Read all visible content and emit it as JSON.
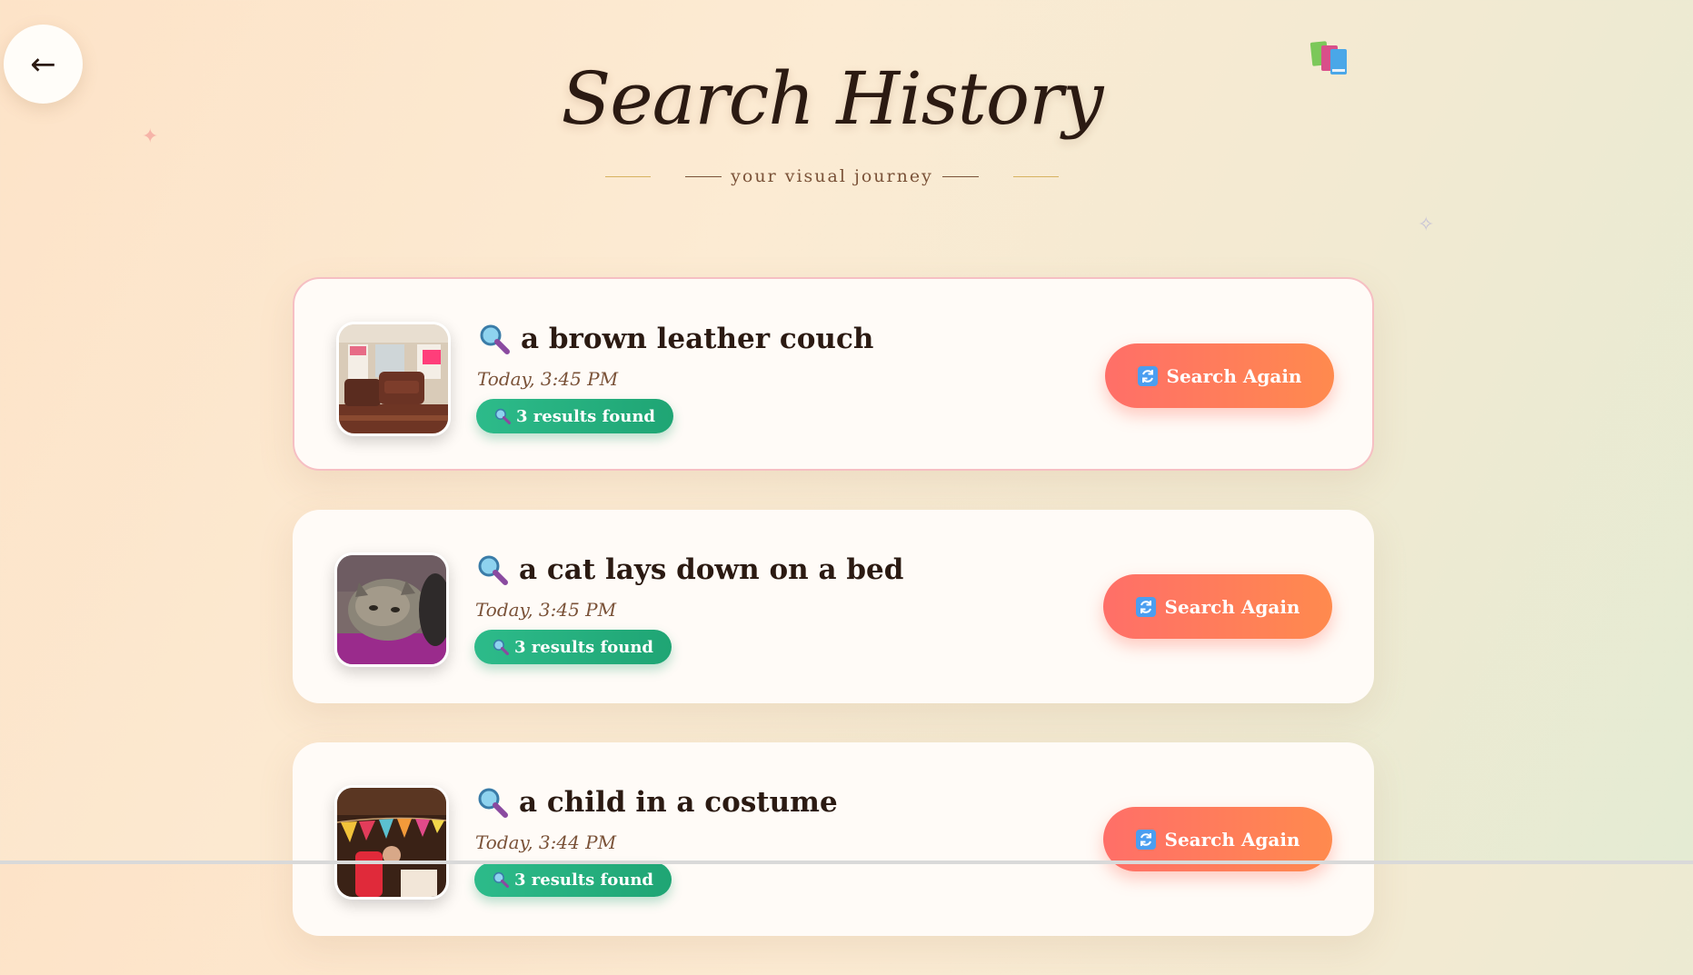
{
  "header": {
    "title": "Search History",
    "subtitle": "your visual journey"
  },
  "back_button": {
    "label": "←"
  },
  "icons": {
    "back": "arrow-left-icon",
    "books": "books-icon",
    "magnifier": "magnifying-glass-icon",
    "refresh": "refresh-icon",
    "sparkle": "sparkle-icon"
  },
  "colors": {
    "accent_button": "#ff7a5c",
    "badge": "#25b381",
    "title": "#2b1a12",
    "timestamp": "#7a5238",
    "active_border": "#f6bfc3"
  },
  "history": [
    {
      "query": "a brown leather couch",
      "timestamp": "Today, 3:45 PM",
      "results": "3 results found",
      "action": "Search Again",
      "active": true,
      "thumbnail": "living-room-couch"
    },
    {
      "query": "a cat lays down on a bed",
      "timestamp": "Today, 3:45 PM",
      "results": "3 results found",
      "action": "Search Again",
      "active": false,
      "thumbnail": "cat-on-bed"
    },
    {
      "query": "a child in a costume",
      "timestamp": "Today, 3:44 PM",
      "results": "3 results found",
      "action": "Search Again",
      "active": false,
      "thumbnail": "party-bunting"
    }
  ]
}
